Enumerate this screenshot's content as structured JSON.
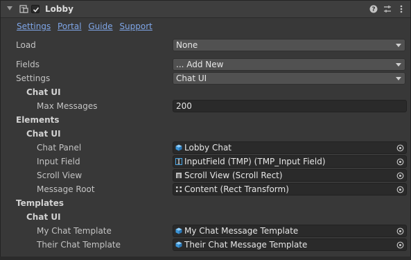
{
  "header": {
    "title": "Lobby",
    "enabled": true
  },
  "links": [
    "Settings",
    "Portal",
    "Guide",
    "Support"
  ],
  "fields": {
    "load": {
      "label": "Load",
      "value": "None"
    },
    "fields": {
      "label": "Fields",
      "value": "... Add New"
    },
    "settings": {
      "label": "Settings",
      "value": "Chat UI"
    }
  },
  "sections": {
    "chat_ui_1": "Chat UI",
    "max_messages": {
      "label": "Max Messages",
      "value": "200"
    },
    "elements": "Elements",
    "chat_ui_2": "Chat UI",
    "chat_panel": {
      "label": "Chat Panel",
      "value": "Lobby Chat",
      "icon": "cube-icon"
    },
    "input_field": {
      "label": "Input Field",
      "value": "InputField (TMP) (TMP_Input Field)",
      "icon": "text-cursor-icon"
    },
    "scroll_view": {
      "label": "Scroll View",
      "value": "Scroll View (Scroll Rect)",
      "icon": "scroll-rect-icon"
    },
    "message_root": {
      "label": "Message Root",
      "value": "Content (Rect Transform)",
      "icon": "rect-transform-icon"
    },
    "templates": "Templates",
    "chat_ui_3": "Chat UI",
    "my_template": {
      "label": "My Chat Template",
      "value": "My Chat Message Template",
      "icon": "cube-icon"
    },
    "their_template": {
      "label": "Their Chat Template",
      "value": "Their Chat Message Template",
      "icon": "cube-icon"
    }
  },
  "colors": {
    "link": "#7fa6e8",
    "background": "#383838",
    "prefab_icon": "#4aa8e8"
  }
}
